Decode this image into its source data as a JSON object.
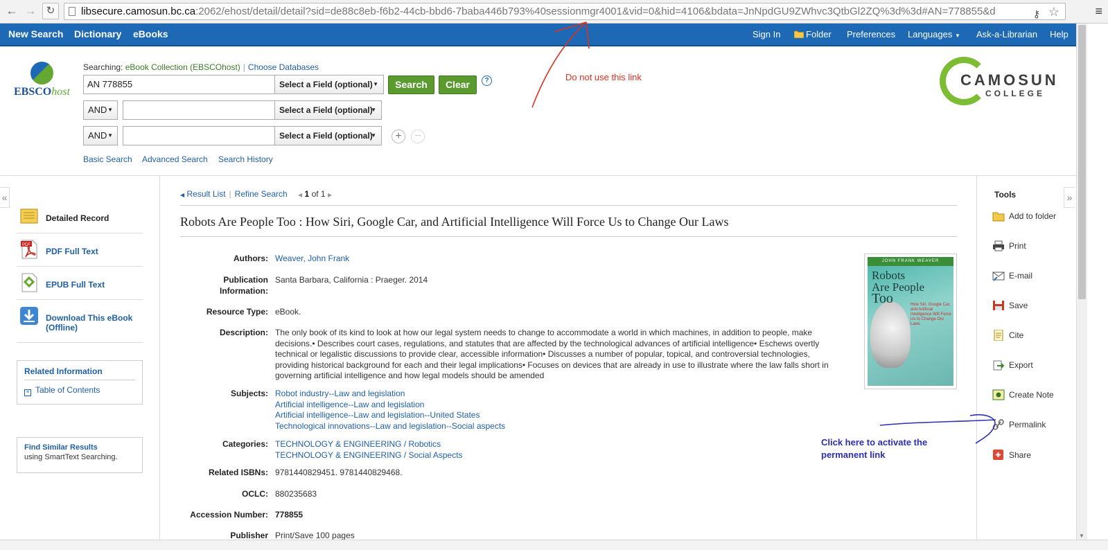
{
  "browser": {
    "url_host": "libsecure.camosun.bc.ca",
    "url_rest": ":2062/ehost/detail/detail?sid=de88c8eb-f6b2-44cb-bbd6-7baba446b793%40sessionmgr4001&vid=0&hid=4106&bdata=JnNpdGU9ZWhvc3QtbGl2ZQ%3d%3d#AN=778855&d"
  },
  "topnav": {
    "new_search": "New Search",
    "dictionary": "Dictionary",
    "ebooks": "eBooks",
    "sign_in": "Sign In",
    "folder": "Folder",
    "preferences": "Preferences",
    "languages": "Languages",
    "ask": "Ask-a-Librarian",
    "help": "Help"
  },
  "search": {
    "searching_label": "Searching:",
    "database": "eBook Collection (EBSCOhost)",
    "choose_db": "Choose Databases",
    "query1": "AN 778855",
    "field_select": "Select a Field (optional)",
    "bool2": "AND",
    "bool3": "AND",
    "search_btn": "Search",
    "clear_btn": "Clear",
    "help": "?",
    "add_row": "+",
    "remove_row": "−",
    "basic": "Basic Search",
    "advanced": "Advanced Search",
    "history": "Search History"
  },
  "logos": {
    "ebsco_main": "EBSCO",
    "ebsco_italic": "host",
    "camosun_name": "CAMOSUN",
    "camosun_sub": "COLLEGE"
  },
  "annotations": {
    "no_link": "Do not use this link",
    "click_1": "Click here to activate the",
    "click_2": "permanent link"
  },
  "left": {
    "formats": {
      "detailed": "Detailed Record",
      "pdf": "PDF Full Text",
      "epub": "EPUB Full Text",
      "download": "Download This eBook (Offline)"
    },
    "related_title": "Related Information",
    "toc": "Table of Contents",
    "similar_title": "Find Similar Results",
    "similar_sub": "using SmartText Searching."
  },
  "result_nav": {
    "result_list": "Result List",
    "refine": "Refine Search",
    "current": "1",
    "of_total": "of 1"
  },
  "record": {
    "title": "Robots Are People Too : How Siri, Google Car, and Artificial Intelligence Will Force Us to Change Our Laws",
    "labels": {
      "authors": "Authors:",
      "publication_1": "Publication",
      "publication_2": "Information:",
      "resource_type": "Resource Type:",
      "description": "Description:",
      "subjects": "Subjects:",
      "categories": "Categories:",
      "isbns": "Related ISBNs:",
      "oclc": "OCLC:",
      "accession": "Accession Number:",
      "publisher": "Publisher"
    },
    "authors": "Weaver, John Frank",
    "publication": "Santa Barbara, California : Praeger. 2014",
    "resource_type": "eBook.",
    "description": "The only book of its kind to look at how our legal system needs to change to accommodate a world in which machines, in addition to people, make decisions.• Describes court cases, regulations, and statutes that are affected by the technological advances of artificial intelligence• Eschews overtly technical or legalistic discussions to provide clear, accessible information• Discusses a number of popular, topical, and controversial technologies, providing historical background for each and their legal implications• Focuses on devices that are already in use to illustrate where the law falls short in governing artificial intelligence and how legal models should be amended",
    "subjects": [
      "Robot industry--Law and legislation",
      "Artificial intelligence--Law and legislation",
      "Artificial intelligence--Law and legislation--United States",
      "Technological innovations--Law and legislation--Social aspects"
    ],
    "categories": [
      "TECHNOLOGY & ENGINEERING / Robotics",
      "TECHNOLOGY & ENGINEERING / Social Aspects"
    ],
    "isbns": "9781440829451. 9781440829468.",
    "oclc": "880235683",
    "accession": "778855",
    "publisher_partial": "Print/Save 100 pages"
  },
  "cover": {
    "band": "JOHN FRANK WEAVER",
    "title_1": "Robots",
    "title_2": "Are People",
    "title_3": "Too",
    "subtitle": "How Siri, Google Car, and Artificial Intelligence Will Force Us to Change Our Laws"
  },
  "tools": {
    "title": "Tools",
    "add_folder": "Add to folder",
    "print": "Print",
    "email": "E-mail",
    "save": "Save",
    "cite": "Cite",
    "export": "Export",
    "note": "Create Note",
    "permalink": "Permalink",
    "share": "Share"
  },
  "colors": {
    "toolbar_blue": "#1d69b6",
    "search_green": "#5a9a2e",
    "annotation_red": "#d9321f",
    "annotation_blue": "#2a2fb3"
  }
}
